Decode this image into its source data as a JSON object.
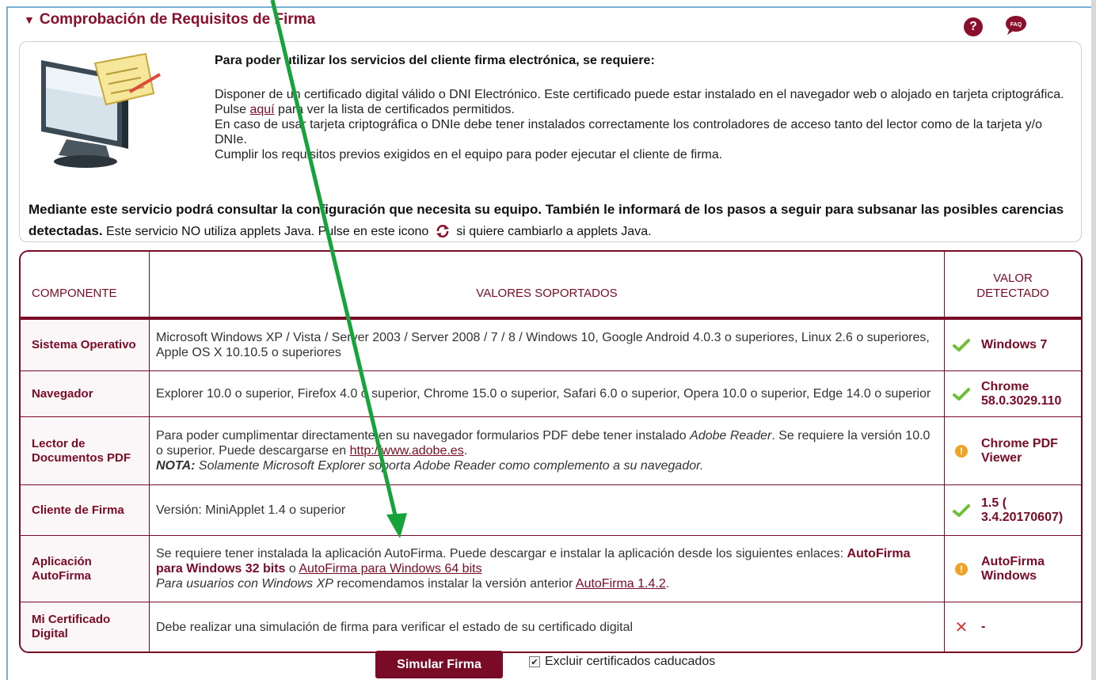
{
  "header": {
    "title": "Comprobación de Requisitos de Firma",
    "help_icon": "question-icon",
    "faq_label": "FAQ"
  },
  "intro": {
    "title": "Para poder utilizar los servicios del cliente firma electrónica, se requiere:",
    "p1_before": "Disponer de un certificado digital válido o DNI Electrónico. Este certificado puede estar instalado en el navegador web o alojado en tarjeta criptográfica. Pulse ",
    "p1_link": "aquí",
    "p1_after": " para ver la lista de certificados permitidos.",
    "p2": "En caso de usar tarjeta criptográfica o DNIe debe tener instalados correctamente los controladores de acceso tanto del lector como de la tarjeta y/o DNIe.",
    "p3": "Cumplir los requisitos previos exigidos en el equipo para poder ejecutar el cliente de firma."
  },
  "service": {
    "bold": "Mediante este servicio podrá consultar la configuración que necesita su equipo. También le informará de los pasos a seguir para subsanar las posibles carencias detectadas.",
    "rest_before": " Este servicio NO utiliza applets Java. Pulse en este icono ",
    "rest_after": " si quiere cambiarlo a applets Java."
  },
  "table": {
    "headers": {
      "component": "COMPONENTE",
      "supported": "VALORES SOPORTADOS",
      "detected_line1": "VALOR",
      "detected_line2": "DETECTADO"
    },
    "rows": [
      {
        "component": "Sistema Operativo",
        "values": "Microsoft Windows XP / Vista / Server 2003 / Server 2008 / 7 / 8 / Windows 10, Google Android 4.0.3 o superiores, Linux 2.6 o superiores, Apple OS X 10.10.5 o superiores",
        "status": "check",
        "detected": "Windows 7"
      },
      {
        "component": "Navegador",
        "values": "Explorer 10.0 o superior, Firefox 4.0 o superior, Chrome 15.0 o superior, Safari 6.0 o superior, Opera 10.0 o superior, Edge 14.0 o superior",
        "status": "check",
        "detected": "Chrome 58.0.3029.110"
      },
      {
        "component": "Lector de Documentos PDF",
        "values_a": "Para poder cumplimentar directamente en su navegador formularios PDF debe tener instalado ",
        "values_em": "Adobe Reader",
        "values_b": ". Se requiere la versión 10.0 o superior. Puede descargarse en ",
        "values_link": "http://www.adobe.es",
        "values_c": ".",
        "note_label": "NOTA:",
        "note_text": " Solamente Microsoft Explorer soporta Adobe Reader como complemento a su navegador.",
        "status": "warning",
        "detected": "Chrome PDF Viewer"
      },
      {
        "component": "Cliente de Firma",
        "values": "Versión: MiniApplet 1.4 o superior",
        "status": "check",
        "detected": "1.5 ( 3.4.20170607)"
      },
      {
        "component": "Aplicación AutoFirma",
        "values_a": "Se requiere tener instalada la aplicación AutoFirma. Puede descargar e instalar la aplicación desde los siguientes enlaces: ",
        "link32": "AutoFirma para Windows 32 bits",
        "values_o": " o ",
        "link64": "AutoFirma para Windows 64 bits",
        "xp_em": "Para usuarios con Windows XP",
        "xp_text": " recomendamos instalar la versión anterior ",
        "xp_link": "AutoFirma 1.4.2",
        "xp_end": ".",
        "status": "warning",
        "detected": "AutoFirma Windows"
      },
      {
        "component": "Mi Certificado Digital",
        "values": "Debe realizar una simulación de firma para verificar el estado de su certificado digital",
        "status": "error",
        "detected": "-"
      }
    ]
  },
  "footer": {
    "button": "Simular Firma",
    "checkbox_label": "Excluir certificados caducados",
    "checkbox_checked": true
  },
  "colors": {
    "brand": "#7a0b26",
    "ok": "#6fbf3a",
    "warning": "#f0a224",
    "error": "#d83a3a",
    "annotation_arrow": "#16a33a"
  }
}
